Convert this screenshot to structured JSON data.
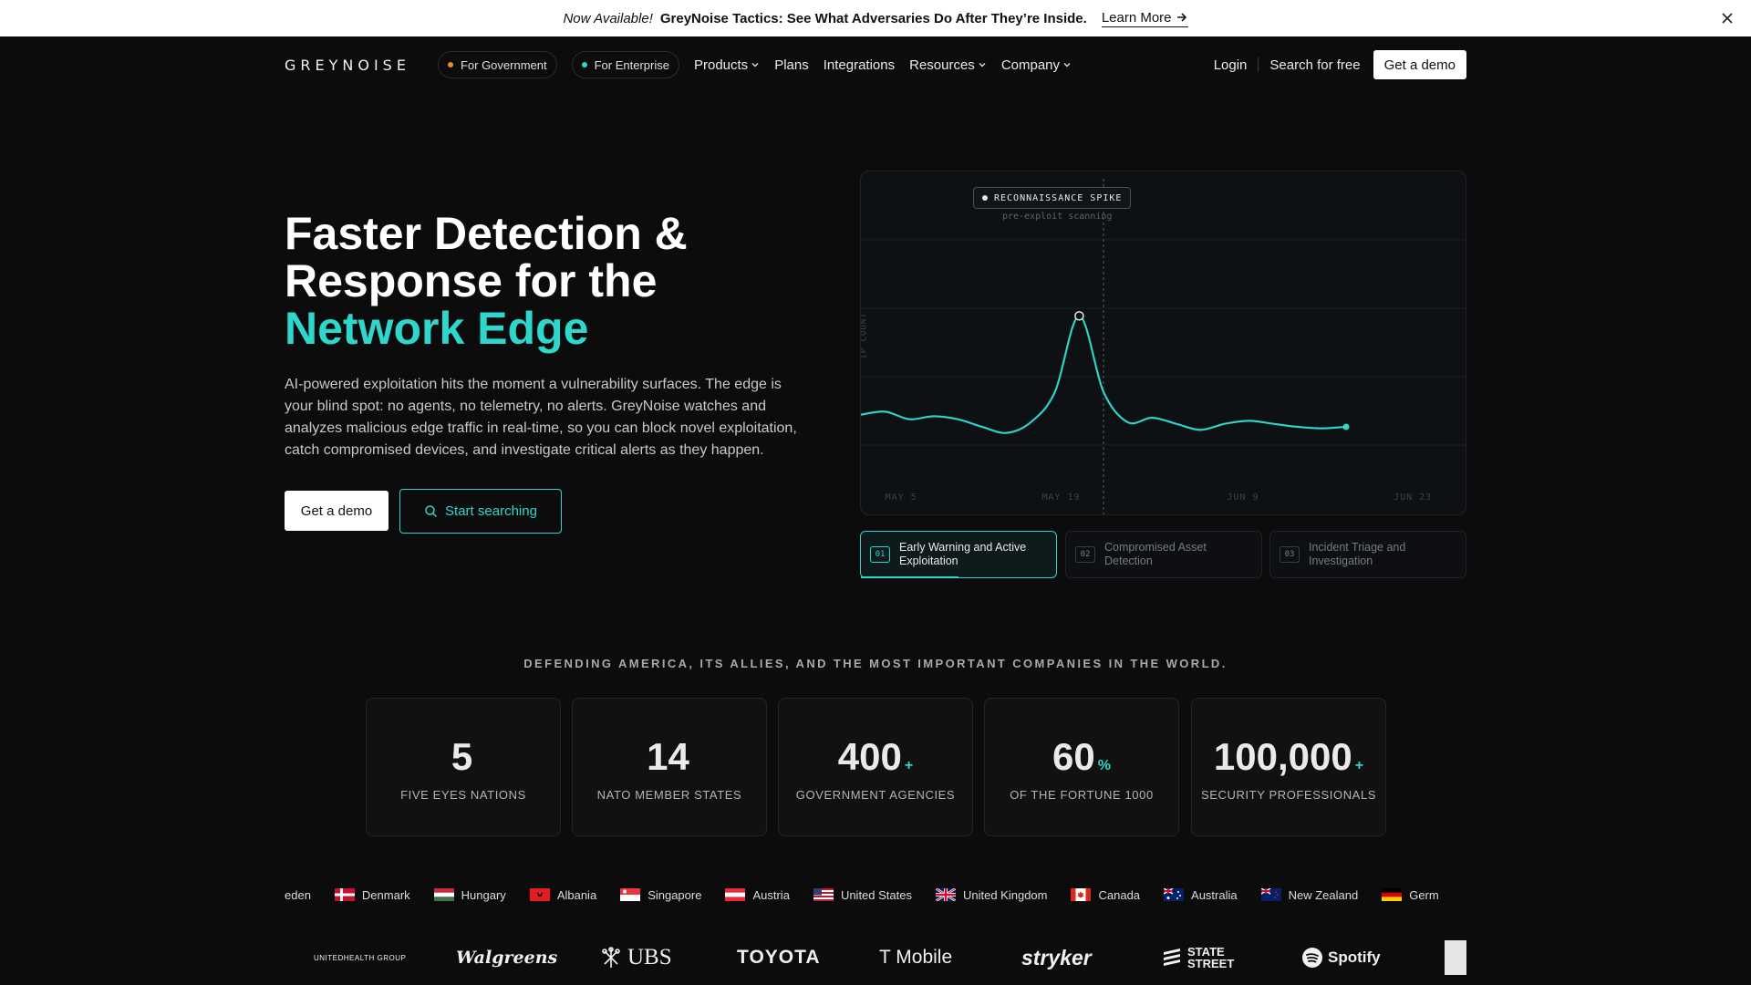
{
  "announcement": {
    "now_available": "Now Available!",
    "headline": "GreyNoise Tactics: See What Adversaries Do After They’re Inside.",
    "learn_more": "Learn More"
  },
  "nav": {
    "logo": "GREYNOISE",
    "pills": [
      {
        "label": "For Government",
        "dot_color": "#f08a24"
      },
      {
        "label": "For Enterprise",
        "dot_color": "#2fd6cc"
      }
    ],
    "links": [
      "Products",
      "Plans",
      "Integrations",
      "Resources",
      "Company"
    ],
    "login": "Login",
    "search_free": "Search for free",
    "get_demo": "Get a demo"
  },
  "hero": {
    "title_line1": "Faster Detection &",
    "title_line2": "Response for the",
    "title_accent": "Network Edge",
    "description": "AI-powered exploitation hits the moment a vulnerability surfaces. The edge is your blind spot: no agents, no telemetry, no alerts. GreyNoise watches and analyzes malicious edge traffic in real-time, so you can block novel exploitation, catch compromised devices, and investigate critical alerts as they happen.",
    "btn_demo": "Get a demo",
    "btn_search": "Start searching"
  },
  "chart": {
    "spike_label": "RECONNAISSANCE SPIKE",
    "spike_sub": "pre-exploit scanning",
    "ylabel": "IP COUNT",
    "x_ticks": [
      "MAY 5",
      "MAY 19",
      "JUN 9",
      "JUN 23"
    ],
    "accent": "#2fd6cc"
  },
  "chart_data": {
    "type": "line",
    "ylabel": "IP COUNT",
    "x_ticks": [
      "MAY 5",
      "MAY 19",
      "JUN 9",
      "JUN 23"
    ],
    "x": [
      0,
      0.04,
      0.08,
      0.12,
      0.16,
      0.2,
      0.24,
      0.28,
      0.32,
      0.36,
      0.4,
      0.44,
      0.48,
      0.52,
      0.56,
      0.6,
      0.64,
      0.68,
      0.72,
      0.76,
      0.8
    ],
    "values": [
      20,
      22,
      17,
      19,
      17,
      12,
      8,
      15,
      35,
      85,
      35,
      15,
      18,
      14,
      10,
      14,
      16,
      14,
      12,
      11,
      12
    ],
    "ylim": [
      0,
      180
    ],
    "annotation": {
      "x": 0.4,
      "label": "RECONNAISSANCE SPIKE",
      "sublabel": "pre-exploit scanning"
    }
  },
  "tabs": [
    {
      "num": "01",
      "label": "Early Warning and Active Exploitation",
      "active": true,
      "progress": 0.5
    },
    {
      "num": "02",
      "label": "Compromised Asset Detection",
      "active": false
    },
    {
      "num": "03",
      "label": "Incident Triage and Investigation",
      "active": false
    }
  ],
  "defending": "DEFENDING AMERICA, ITS ALLIES, AND THE MOST IMPORTANT COMPANIES IN THE WORLD.",
  "stats": [
    {
      "value": "5",
      "suffix": "",
      "caption": "FIVE EYES NATIONS"
    },
    {
      "value": "14",
      "suffix": "",
      "caption": "NATO MEMBER STATES"
    },
    {
      "value": "400",
      "suffix": "+",
      "caption": "GOVERNMENT AGENCIES"
    },
    {
      "value": "60",
      "suffix": "%",
      "caption": "OF THE FORTUNE 1000"
    },
    {
      "value": "100,000",
      "suffix": "+",
      "caption": "SECURITY PROFESSIONALS"
    }
  ],
  "countries": [
    "eden",
    "Denmark",
    "Hungary",
    "Albania",
    "Singapore",
    "Austria",
    "United States",
    "United Kingdom",
    "Canada",
    "Australia",
    "New Zealand",
    "Germ"
  ],
  "logos": [
    "UNITEDHEALTH GROUP",
    "Walgreens",
    "UBS",
    "TOYOTA",
    "T Mobile",
    "stryker",
    "STATE STREET",
    "Spotify"
  ]
}
